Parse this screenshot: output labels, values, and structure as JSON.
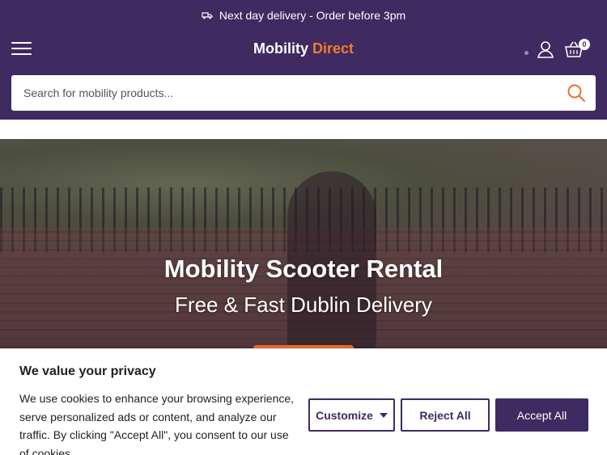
{
  "promo": {
    "text": "Next day delivery - Order before 3pm",
    "icon": "truck-icon"
  },
  "header": {
    "logo_part1": "Mobility",
    "logo_part2": "Direct",
    "cart_count": "0",
    "icons": [
      "menu-icon",
      "user-icon",
      "basket-icon",
      "search-icon"
    ]
  },
  "search": {
    "placeholder": "Search for mobility products..."
  },
  "hero": {
    "title": "Mobility Scooter Rental",
    "subtitle": "Free & Fast Dublin Delivery"
  },
  "cookie": {
    "title": "We value your privacy",
    "text": "We use cookies to enhance your browsing experience, serve personalized ads or content, and analyze our traffic. By clicking \"Accept All\", you consent to our use of cookies.",
    "customize_label": "Customize",
    "reject_label": "Reject All",
    "accept_label": "Accept All"
  },
  "colors": {
    "brand_purple": "#3f2a62",
    "accent_orange": "#f07c27",
    "white": "#ffffff"
  }
}
